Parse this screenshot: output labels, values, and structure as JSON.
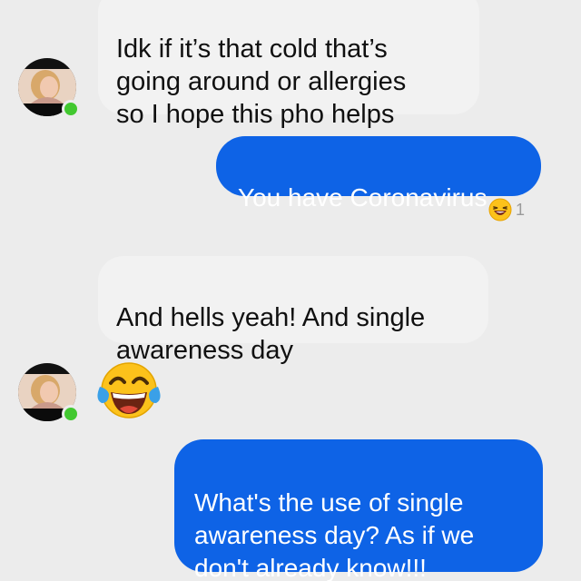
{
  "messages": [
    {
      "direction": "incoming",
      "text": "Idk if it’s that cold that’s\ngoing around or allergies\nso I hope this pho helps"
    },
    {
      "direction": "outgoing",
      "text": "You have Coronavirus",
      "reaction": {
        "icon": "laughing-emoji-icon",
        "count": "1"
      }
    },
    {
      "direction": "incoming",
      "text": "And hells yeah! And single\nawareness day"
    },
    {
      "direction": "incoming",
      "type": "emoji",
      "icon": "tears-of-joy-emoji-icon"
    },
    {
      "direction": "outgoing",
      "text": "What's the use of single\nawareness day? As if we\ndon't already know!!!"
    }
  ],
  "colors": {
    "background": "#ececec",
    "outgoing_bubble": "#0e63e6",
    "incoming_bubble": "#f2f2f2",
    "online_indicator": "#42c830"
  }
}
